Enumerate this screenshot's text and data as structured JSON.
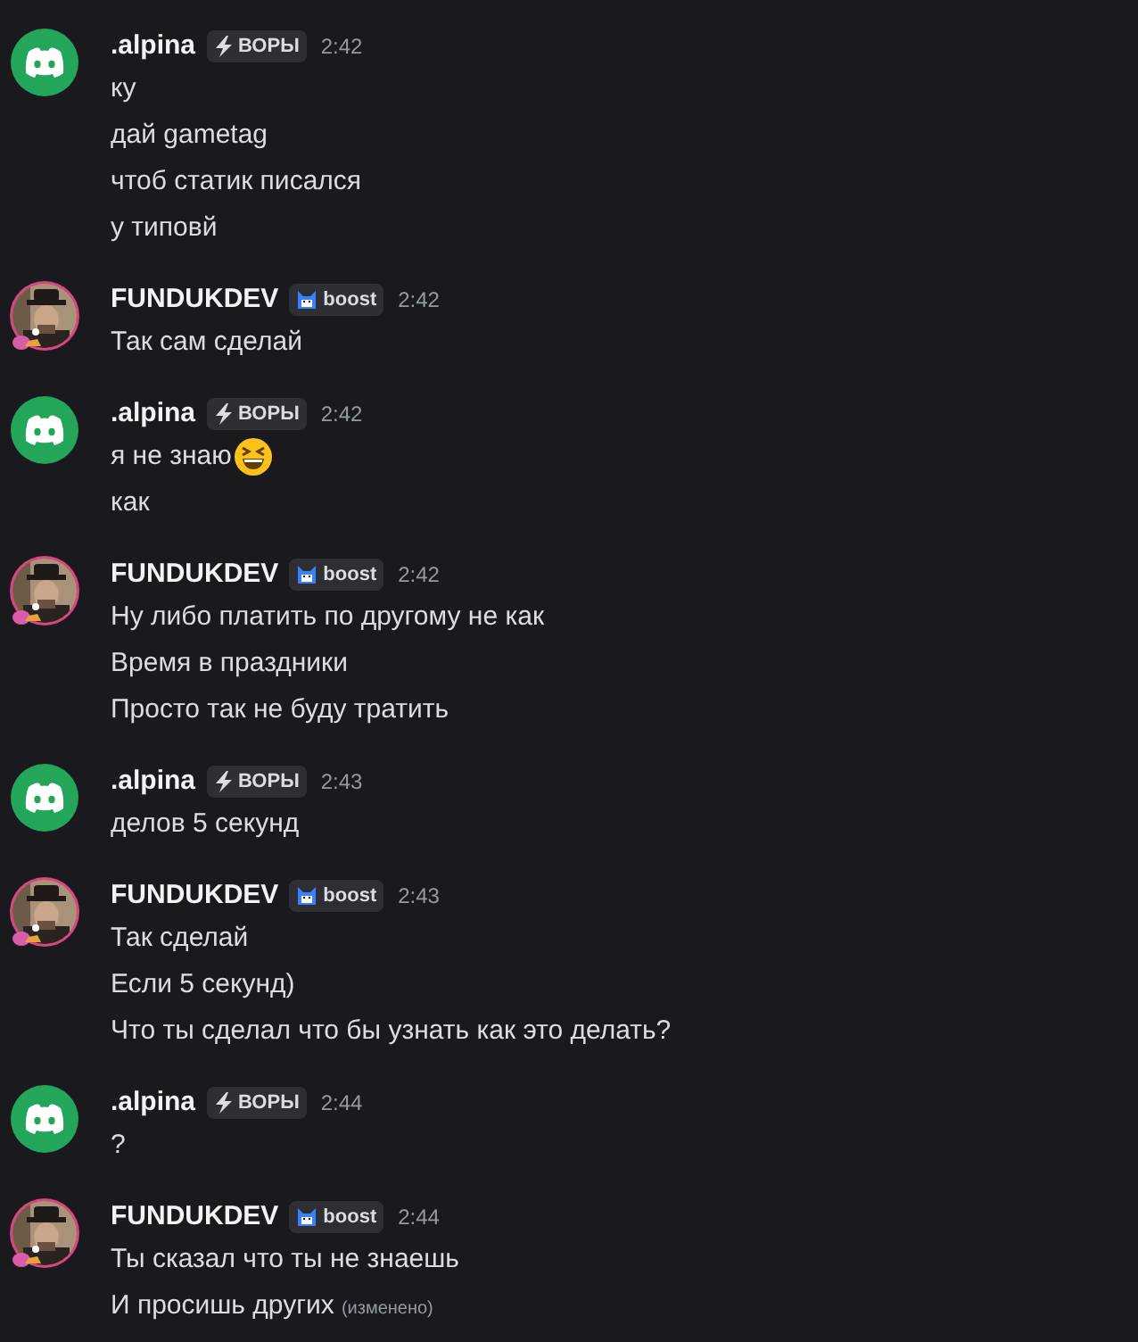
{
  "messages": [
    {
      "author": ".alpina",
      "kind": "discord",
      "badge": {
        "kind": "bolt",
        "label": "ВОРЫ"
      },
      "time": "2:42",
      "lines": [
        {
          "text": "ку"
        },
        {
          "text": "дай gametag"
        },
        {
          "text": "чтоб статик писался"
        },
        {
          "text": "у типовй"
        }
      ]
    },
    {
      "author": "FUNDUKDEV",
      "badge": {
        "kind": "boost",
        "label": "boost"
      },
      "time": "2:42",
      "lines": [
        {
          "text": "Так сам сделай"
        }
      ]
    },
    {
      "author": ".alpina",
      "kind": "discord",
      "badge": {
        "kind": "bolt",
        "label": "ВОРЫ"
      },
      "time": "2:42",
      "lines": [
        {
          "text": "я не знаю",
          "emoji": true
        },
        {
          "text": "как"
        }
      ]
    },
    {
      "author": "FUNDUKDEV",
      "badge": {
        "kind": "boost",
        "label": "boost"
      },
      "time": "2:42",
      "lines": [
        {
          "text": "Ну либо платить по другому не как"
        },
        {
          "text": "Время в праздники"
        },
        {
          "text": "Просто так не буду тратить"
        }
      ]
    },
    {
      "author": ".alpina",
      "kind": "discord",
      "badge": {
        "kind": "bolt",
        "label": "ВОРЫ"
      },
      "time": "2:43",
      "lines": [
        {
          "text": "делов 5 секунд"
        }
      ]
    },
    {
      "author": "FUNDUKDEV",
      "badge": {
        "kind": "boost",
        "label": "boost"
      },
      "time": "2:43",
      "lines": [
        {
          "text": "Так сделай"
        },
        {
          "text": "Если 5 секунд)"
        },
        {
          "text": "Что ты сделал что бы узнать как это делать?"
        }
      ]
    },
    {
      "author": ".alpina",
      "kind": "discord",
      "badge": {
        "kind": "bolt",
        "label": "ВОРЫ"
      },
      "time": "2:44",
      "lines": [
        {
          "text": "?"
        }
      ]
    },
    {
      "author": "FUNDUKDEV",
      "badge": {
        "kind": "boost",
        "label": "boost"
      },
      "time": "2:44",
      "lines": [
        {
          "text": "Ты сказал что ты не знаешь"
        },
        {
          "text": "И просишь других",
          "edited": "(изменено)"
        }
      ]
    }
  ]
}
